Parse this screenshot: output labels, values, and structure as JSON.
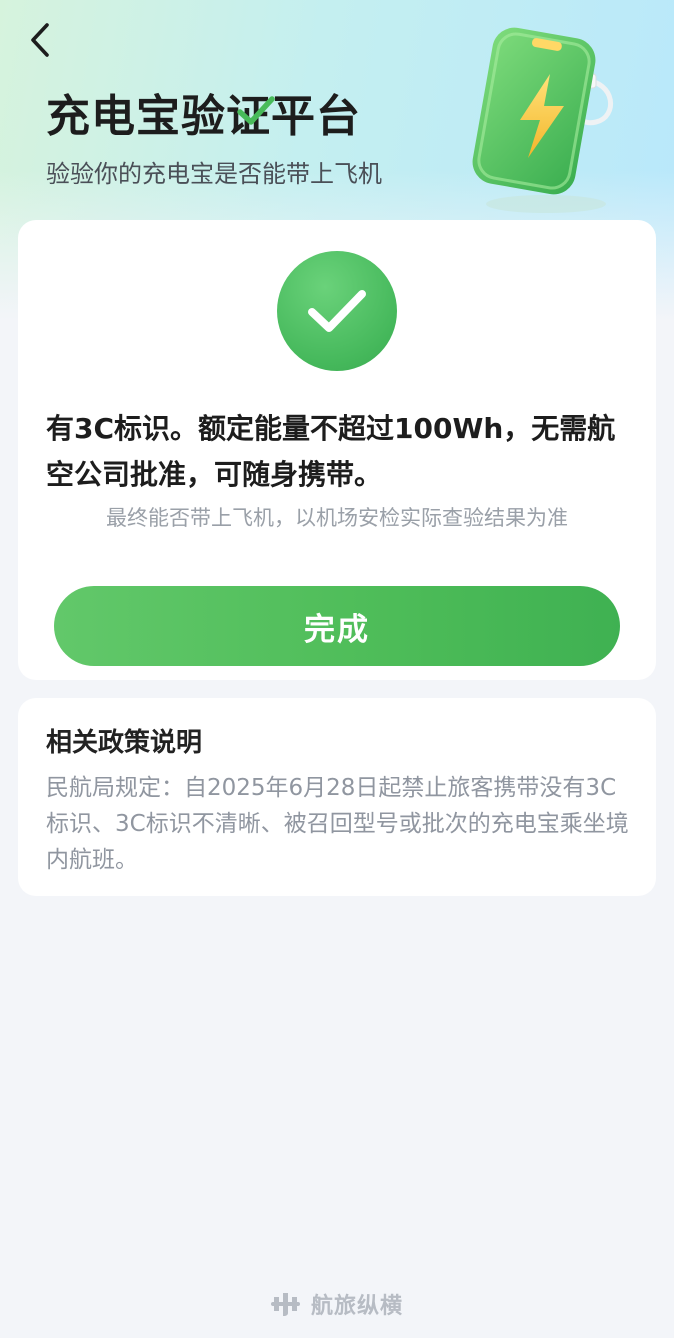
{
  "header": {
    "title": "充电宝验证平台",
    "subtitle": "验验你的充电宝是否能带上飞机",
    "back_icon": "chevron-left-icon",
    "illustration_icon": "power-bank-lightning-icon"
  },
  "result": {
    "status_icon": "check-circle-icon",
    "message": "有3C标识。额定能量不超过100Wh，无需航空公司批准，可随身携带。",
    "note": "最终能否带上飞机，以机场安检实际查验结果为准",
    "done_label": "完成"
  },
  "policy": {
    "title": "相关政策说明",
    "body": "民航局规定：自2025年6月28日起禁止旅客携带没有3C标识、3C标识不清晰、被召回型号或批次的充电宝乘坐境内航班。"
  },
  "footer": {
    "brand": "航旅纵横",
    "logo_icon": "hanglv-logo-icon"
  },
  "colors": {
    "accent_green": "#4dbc58",
    "background": "#f3f5f9",
    "header_gradient_start": "#d6f3dd",
    "header_gradient_end": "#b9e8fb"
  }
}
